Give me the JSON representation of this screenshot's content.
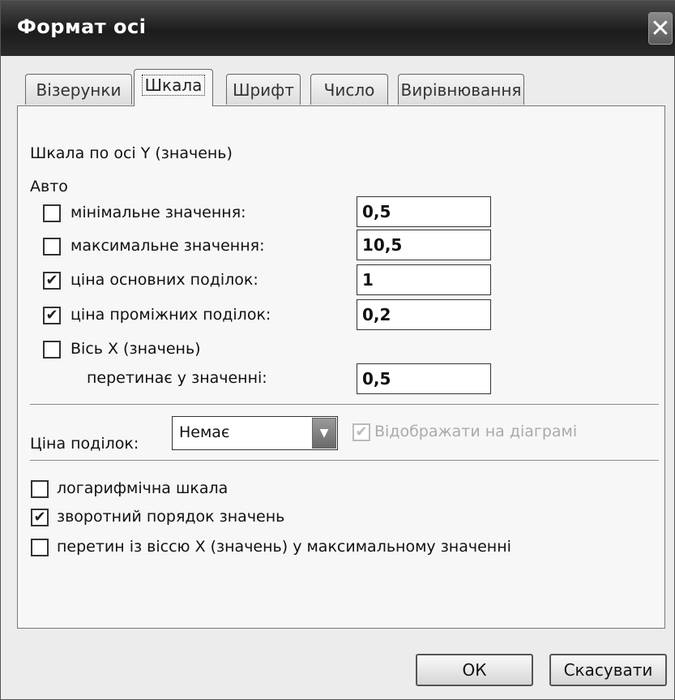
{
  "window": {
    "title": "Формат осі",
    "close_glyph": "✕"
  },
  "tabs": [
    {
      "label": "Візерунки"
    },
    {
      "label": "Шкала"
    },
    {
      "label": "Шрифт"
    },
    {
      "label": "Число"
    },
    {
      "label": "Вирівнювання"
    }
  ],
  "scale": {
    "heading": "Шкала по осі Y (значень)",
    "auto_label": "Авто",
    "min": {
      "label": "мінімальне значення:",
      "checked": false,
      "value": "0,5"
    },
    "max": {
      "label": "максимальне значення:",
      "checked": false,
      "value": "10,5"
    },
    "major": {
      "label": "ціна основних поділок:",
      "checked": true,
      "value": "1"
    },
    "minor": {
      "label": "ціна проміжних поділок:",
      "checked": true,
      "value": "0,2"
    },
    "cross": {
      "label": "Вісь X (значень)",
      "checked": false
    },
    "cross_at": {
      "label": "перетинає у значенні:",
      "value": "0,5"
    }
  },
  "units": {
    "label": "Ціна поділок:",
    "selected": "Немає",
    "show_label": "Відображати на діаграмі",
    "show_checked": true
  },
  "options": {
    "log": {
      "label": "логарифмічна шкала",
      "checked": false
    },
    "reverse": {
      "label": "зворотний порядок значень",
      "checked": true
    },
    "cross_max": {
      "label": "перетин із віссю X (значень) у максимальному значенні",
      "checked": false
    }
  },
  "buttons": {
    "ok": "ОК",
    "cancel": "Скасувати"
  },
  "check_glyph": "✔"
}
